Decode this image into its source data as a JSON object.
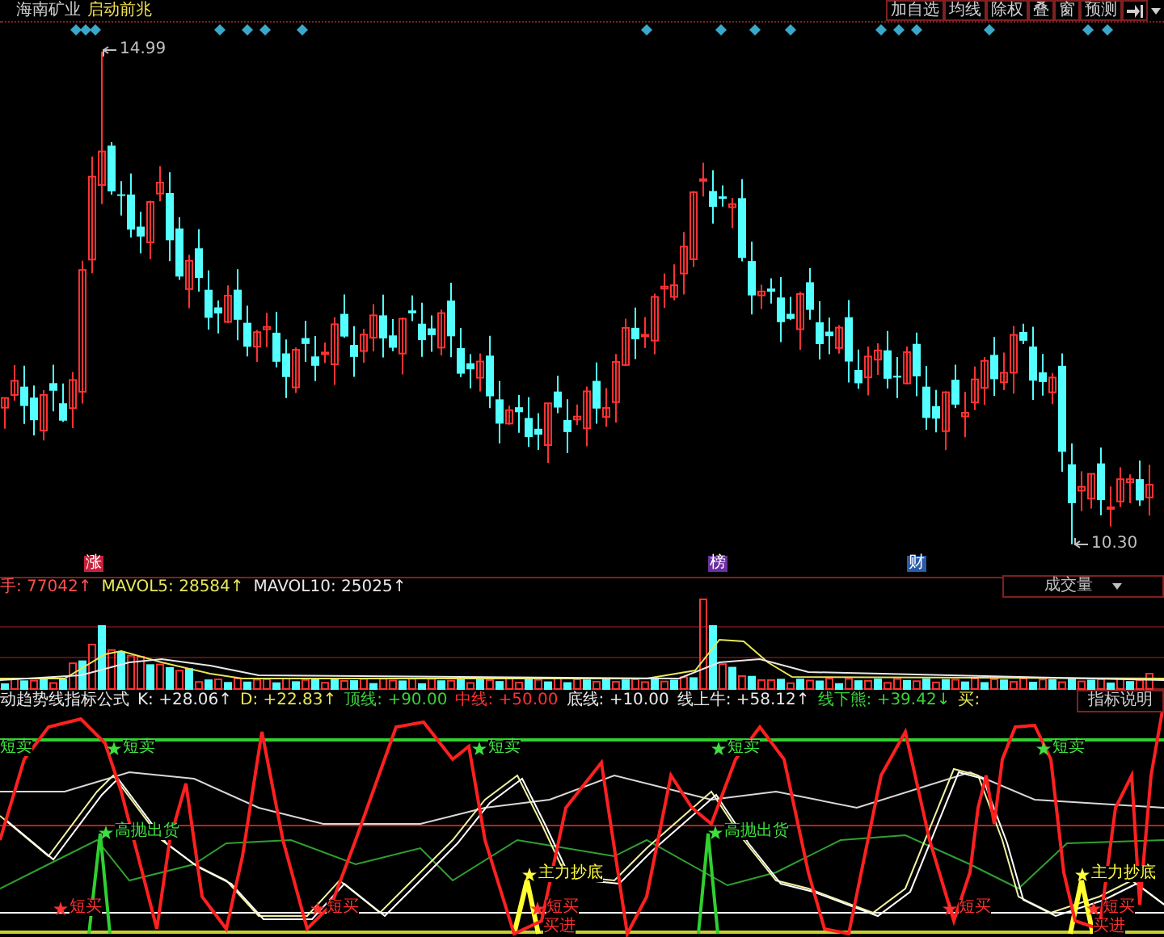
{
  "header": {
    "stock_name": "海南矿业",
    "signal_name": "启动前兆"
  },
  "toolbar": [
    {
      "label": "加自选"
    },
    {
      "label": "均线"
    },
    {
      "label": "除权"
    },
    {
      "label": "叠"
    },
    {
      "label": "窗"
    },
    {
      "label": "预测"
    }
  ],
  "price_chart": {
    "high_label": "14.99",
    "low_label": "10.30",
    "event_tags": [
      {
        "label": "涨",
        "color": "#c8203a"
      },
      {
        "label": "榜",
        "color": "#6a2fa0"
      },
      {
        "label": "财",
        "color": "#2a5aa8"
      }
    ]
  },
  "volume_panel": {
    "readouts": [
      {
        "label": "手: 77042↑",
        "color": "#ff5050"
      },
      {
        "label": "MAVOL5: 28584↑",
        "color": "#e6e65a"
      },
      {
        "label": "MAVOL10: 25025↑",
        "color": "#e8e8e8"
      }
    ],
    "selector": "成交量"
  },
  "indicator_panel": {
    "readouts": [
      {
        "label": "动趋势线指标公式",
        "color": "#e8e8e8"
      },
      {
        "label": "K: +28.06↑",
        "color": "#e8e8e8"
      },
      {
        "label": "D: +22.83↑",
        "color": "#e6e65a"
      },
      {
        "label": "顶线: +90.00",
        "color": "#3ad23a"
      },
      {
        "label": "中线: +50.00",
        "color": "#ff3232"
      },
      {
        "label": "底线: +10.00",
        "color": "#e8e8e8"
      },
      {
        "label": "线上牛: +58.12↑",
        "color": "#e8e8e8"
      },
      {
        "label": "线下熊: +39.42↓",
        "color": "#3ad23a"
      },
      {
        "label": "买:",
        "color": "#e6e65a"
      }
    ],
    "help_button": "指标说明",
    "signals": [
      {
        "label": "短卖",
        "kind": "sell",
        "starred": false
      },
      {
        "label": "短卖",
        "kind": "sell",
        "starred": true
      },
      {
        "label": "高抛出货",
        "kind": "sell",
        "starred": true
      },
      {
        "label": "短买",
        "kind": "buy",
        "starred": true
      },
      {
        "label": "短买",
        "kind": "buy",
        "starred": true
      },
      {
        "label": "短卖",
        "kind": "sell",
        "starred": true
      },
      {
        "label": "主力抄底",
        "kind": "bottom",
        "starred": true
      },
      {
        "label": "短买",
        "kind": "buy",
        "starred": true
      },
      {
        "label": "买进",
        "kind": "buy",
        "starred": false
      },
      {
        "label": "短卖",
        "kind": "sell",
        "starred": true
      },
      {
        "label": "高抛出货",
        "kind": "sell",
        "starred": true
      },
      {
        "label": "短买",
        "kind": "buy",
        "starred": true
      },
      {
        "label": "短卖",
        "kind": "sell",
        "starred": true
      },
      {
        "label": "主力抄底",
        "kind": "bottom",
        "starred": true
      },
      {
        "label": "短买",
        "kind": "buy",
        "starred": true
      },
      {
        "label": "买进",
        "kind": "buy",
        "starred": false
      }
    ]
  }
}
